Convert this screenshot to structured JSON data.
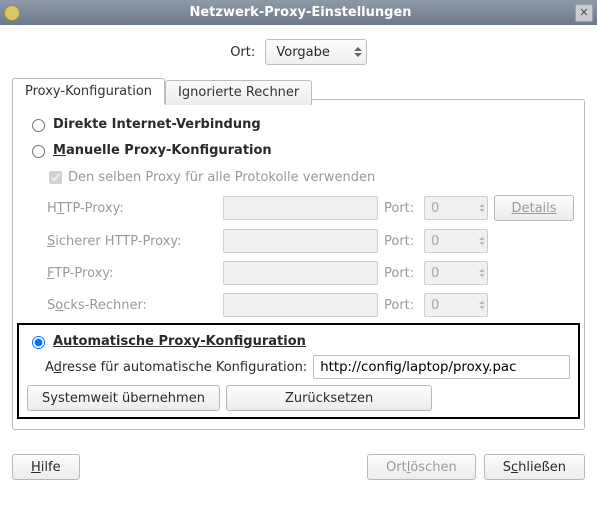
{
  "window": {
    "title": "Netzwerk-Proxy-Einstellungen"
  },
  "location": {
    "label": "Ort:",
    "value": "Vorgabe"
  },
  "tabs": {
    "proxy": "Proxy-Konfiguration",
    "ignored": "Ignorierte Rechner"
  },
  "options": {
    "direct": "Direkte Internet-Verbindung",
    "manual": "Manuelle Proxy-Konfiguration",
    "auto": "Automatische Proxy-Konfiguration"
  },
  "same_proxy": "Den selben Proxy für alle Protokolle verwenden",
  "fields": {
    "http": "HTTP-Proxy:",
    "shttp": "Sicherer HTTP-Proxy:",
    "ftp": "FTP-Proxy:",
    "socks": "Socks-Rechner:",
    "port": "Port:",
    "port_zero": "0",
    "details": "Details"
  },
  "auto": {
    "addr_label": "Adresse für automatische Konfiguration:",
    "url": "http://config/laptop/proxy.pac"
  },
  "buttons": {
    "apply_sys": "Systemweit übernehmen",
    "reset": "Zurücksetzen",
    "help": "Hilfe",
    "del_loc": "Ort löschen",
    "close": "Schließen"
  }
}
